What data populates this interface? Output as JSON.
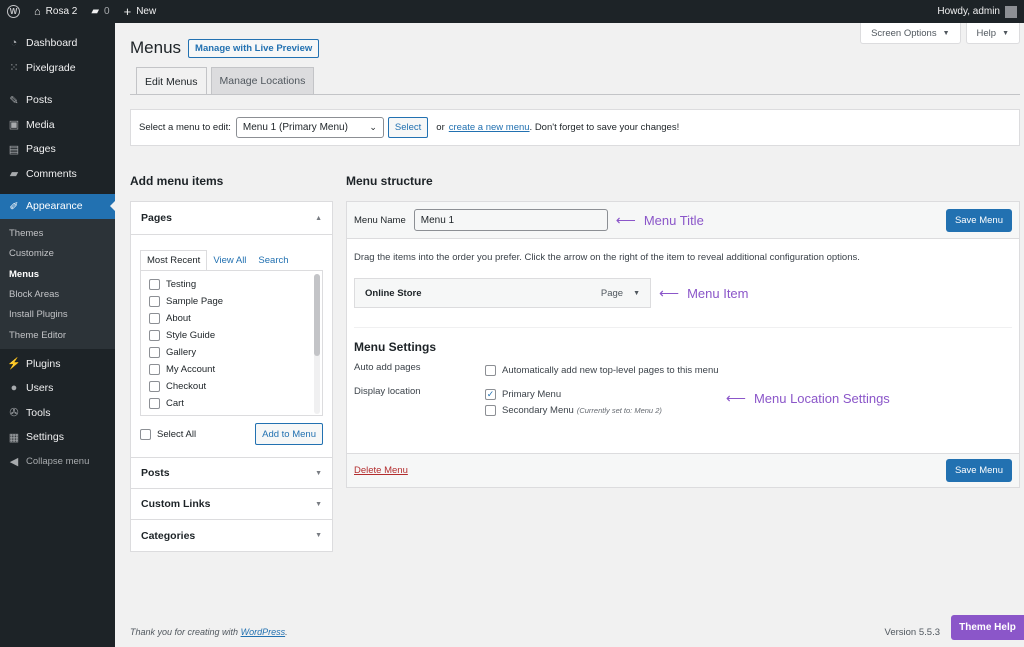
{
  "adminbar": {
    "site_name": "Rosa 2",
    "comments_count": "0",
    "new_label": "New",
    "howdy": "Howdy, admin"
  },
  "sidebar": {
    "items": [
      {
        "label": "Dashboard",
        "icon": "dashboard-icon"
      },
      {
        "label": "Pixelgrade",
        "icon": "grid-icon"
      },
      {
        "label": "Posts",
        "icon": "pin-icon"
      },
      {
        "label": "Media",
        "icon": "media-icon"
      },
      {
        "label": "Pages",
        "icon": "page-icon"
      },
      {
        "label": "Comments",
        "icon": "comment-icon"
      },
      {
        "label": "Appearance",
        "icon": "brush-icon"
      },
      {
        "label": "Plugins",
        "icon": "plugin-icon"
      },
      {
        "label": "Users",
        "icon": "user-icon"
      },
      {
        "label": "Tools",
        "icon": "wrench-icon"
      },
      {
        "label": "Settings",
        "icon": "settings-icon"
      },
      {
        "label": "Collapse menu",
        "icon": "collapse-icon"
      }
    ],
    "appearance_sub": [
      "Themes",
      "Customize",
      "Menus",
      "Block Areas",
      "Install Plugins",
      "Theme Editor"
    ]
  },
  "screen_meta": {
    "screen_options": "Screen Options",
    "help": "Help"
  },
  "page": {
    "title": "Menus",
    "live_preview": "Manage with Live Preview",
    "tabs": [
      "Edit Menus",
      "Manage Locations"
    ]
  },
  "select_bar": {
    "label": "Select a menu to edit:",
    "selected": "Menu 1 (Primary Menu)",
    "select_button": "Select",
    "or": "or",
    "create_link": "create a new menu",
    "suffix": ". Don't forget to save your changes!"
  },
  "add_items": {
    "heading": "Add menu items",
    "pages_title": "Pages",
    "inner_tabs": [
      "Most Recent",
      "View All",
      "Search"
    ],
    "pages": [
      "Testing",
      "Sample Page",
      "About",
      "Style Guide",
      "Gallery",
      "My Account",
      "Checkout",
      "Cart"
    ],
    "select_all": "Select All",
    "add_button": "Add to Menu",
    "collapsed": [
      "Posts",
      "Custom Links",
      "Categories"
    ]
  },
  "structure": {
    "heading": "Menu structure",
    "name_label": "Menu Name",
    "name_value": "Menu 1",
    "save_label": "Save Menu",
    "instructions": "Drag the items into the order you prefer. Click the arrow on the right of the item to reveal additional configuration options.",
    "item_title": "Online Store",
    "item_type": "Page",
    "settings_title": "Menu Settings",
    "auto_add_label": "Auto add pages",
    "auto_add_option": "Automatically add new top-level pages to this menu",
    "display_label": "Display location",
    "primary": "Primary Menu",
    "secondary": "Secondary Menu",
    "secondary_note": "(Currently set to: Menu 2)",
    "delete": "Delete Menu"
  },
  "annotations": {
    "title": "Menu Title",
    "item": "Menu Item",
    "location": "Menu Location Settings"
  },
  "footer": {
    "thanks": "Thank you for creating with",
    "wp_link": "WordPress",
    "dot": ".",
    "version": "Version 5.5.3",
    "theme_help": "Theme Help"
  },
  "colors": {
    "accent": "#2271b1",
    "annotation": "#8b56c9",
    "admin_dark": "#1d2327"
  }
}
